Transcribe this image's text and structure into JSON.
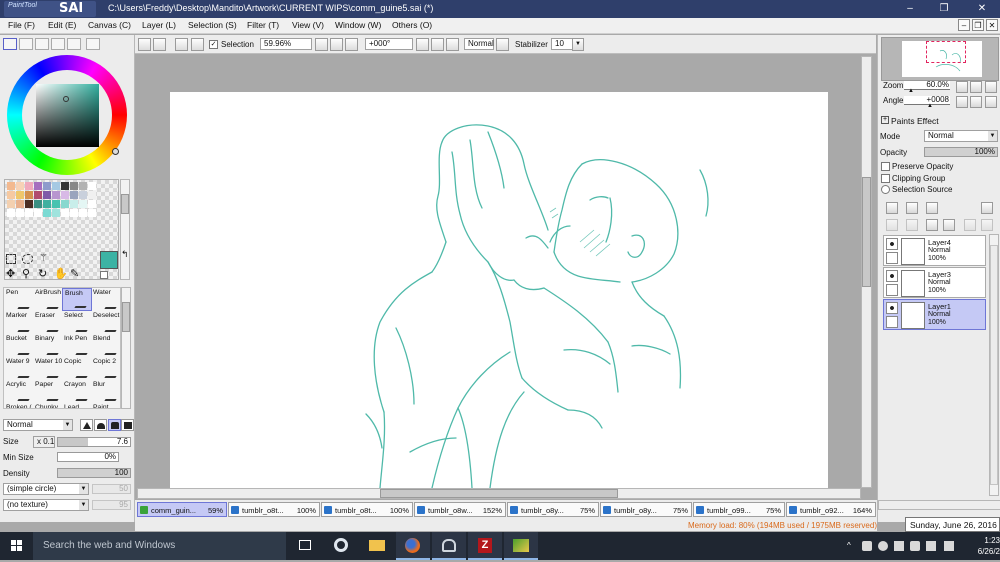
{
  "window": {
    "app_name": "SAI",
    "app_subtitle": "PaintTool",
    "title": "C:\\Users\\Freddy\\Desktop\\Mandito\\Artwork\\CURRENT WIPS\\comm_guine5.sai (*)",
    "controls": [
      "–",
      "❐",
      "✕"
    ]
  },
  "menu": [
    "File (F)",
    "Edit (E)",
    "Canvas (C)",
    "Layer (L)",
    "Selection (S)",
    "Filter (T)",
    "View (V)",
    "Window (W)",
    "Others (O)"
  ],
  "toolbar": {
    "selection_label": "Selection",
    "selection_checked": true,
    "zoom": "59.96%",
    "angle": "+000°",
    "blend": "Normal",
    "stabilizer_label": "Stabilizer",
    "stabilizer_value": "10"
  },
  "color": {
    "current": "#3cb3a4",
    "palette": [
      "#f3b98f",
      "#f7d2b6",
      "#f0a9bc",
      "#a66fbf",
      "#8e9bcc",
      "#a5c9e3",
      "#333333",
      "#888888",
      "#b3b3b3",
      "#ffffff",
      "#f6c9a1",
      "#efc76b",
      "#d4914e",
      "#b14b6e",
      "#7e5aa8",
      "#b895cf",
      "#d8b9e6",
      "#9aa4bd",
      "#c9d0dc",
      "#f0f0f0",
      "#f3d0b0",
      "#e8b08d",
      "#4b2d24",
      "#3b8f82",
      "#3fb0a0",
      "#47c3b0",
      "#88d8cf",
      "#c8eeea",
      "#e4f6f4",
      "#ffffff",
      "#ffffff",
      "#ffffff",
      "#ffffff",
      "#ffffff",
      "#7bdad3",
      "#9fe3dd",
      "#ffffff",
      "#ffffff",
      "#ffffff",
      "#ffffff"
    ]
  },
  "tools": [
    [
      "Pen",
      "AirBrush",
      "Brush",
      "Water"
    ],
    [
      "Marker",
      "Eraser",
      "Select",
      "Deselect"
    ],
    [
      "Bucket",
      "Binary",
      "Ink Pen",
      "Blend"
    ],
    [
      "Water 9",
      "Water 10",
      "Copic",
      "Copic 2"
    ],
    [
      "Acrylic",
      "Paper",
      "Crayon",
      "Blur"
    ],
    [
      "Broken (",
      "Chunky",
      "Lead",
      "Paint"
    ]
  ],
  "selected_tool": "Brush",
  "brush": {
    "mode": "Normal",
    "size_label": "Size",
    "size_mult": "x 0.1",
    "size_value": "7.6",
    "minsize_label": "Min Size",
    "minsize_value": "0%",
    "density_label": "Density",
    "density_value": "100",
    "shape": "(simple circle)",
    "shape_value": "50",
    "texture": "(no texture)",
    "texture_value": "95"
  },
  "navigator": {
    "zoom_label": "Zoom",
    "zoom_value": "60.0%",
    "angle_label": "Angle",
    "angle_value": "+0008"
  },
  "paints_effect": {
    "header": "Paints Effect",
    "mode_label": "Mode",
    "mode_value": "Normal",
    "opacity_label": "Opacity",
    "opacity_value": "100%",
    "preserve_opacity": "Preserve Opacity",
    "clipping_group": "Clipping Group",
    "selection_source": "Selection Source"
  },
  "layers": [
    {
      "name": "Layer4",
      "mode": "Normal",
      "opacity": "100%"
    },
    {
      "name": "Layer3",
      "mode": "Normal",
      "opacity": "100%"
    },
    {
      "name": "Layer1",
      "mode": "Normal",
      "opacity": "100%"
    }
  ],
  "selected_layer": "Layer1",
  "tabs": [
    {
      "name": "comm_guin...",
      "pct": "59%"
    },
    {
      "name": "tumblr_o8t...",
      "pct": "100%"
    },
    {
      "name": "tumblr_o8t...",
      "pct": "100%"
    },
    {
      "name": "tumblr_o8w...",
      "pct": "152%"
    },
    {
      "name": "tumblr_o8y...",
      "pct": "75%"
    },
    {
      "name": "tumblr_o8y...",
      "pct": "75%"
    },
    {
      "name": "tumblr_o99...",
      "pct": "75%"
    },
    {
      "name": "tumblr_o92...",
      "pct": "164%"
    }
  ],
  "status": {
    "memory": "Memory load: 80% (194MB used / 1975MB reserved)",
    "tooltip": "Sunday, June 26, 2016"
  },
  "taskbar": {
    "search_placeholder": "Search the web and Windows",
    "time": "1:23",
    "date": "6/26/2"
  },
  "colors": {
    "title_bar": "#2f3f6b",
    "panel": "#ececec",
    "selection": "#c5c9f5",
    "sketch_line": "#4fb9a9",
    "memory_text": "#d96a1c",
    "taskbar": "#1f2631"
  }
}
